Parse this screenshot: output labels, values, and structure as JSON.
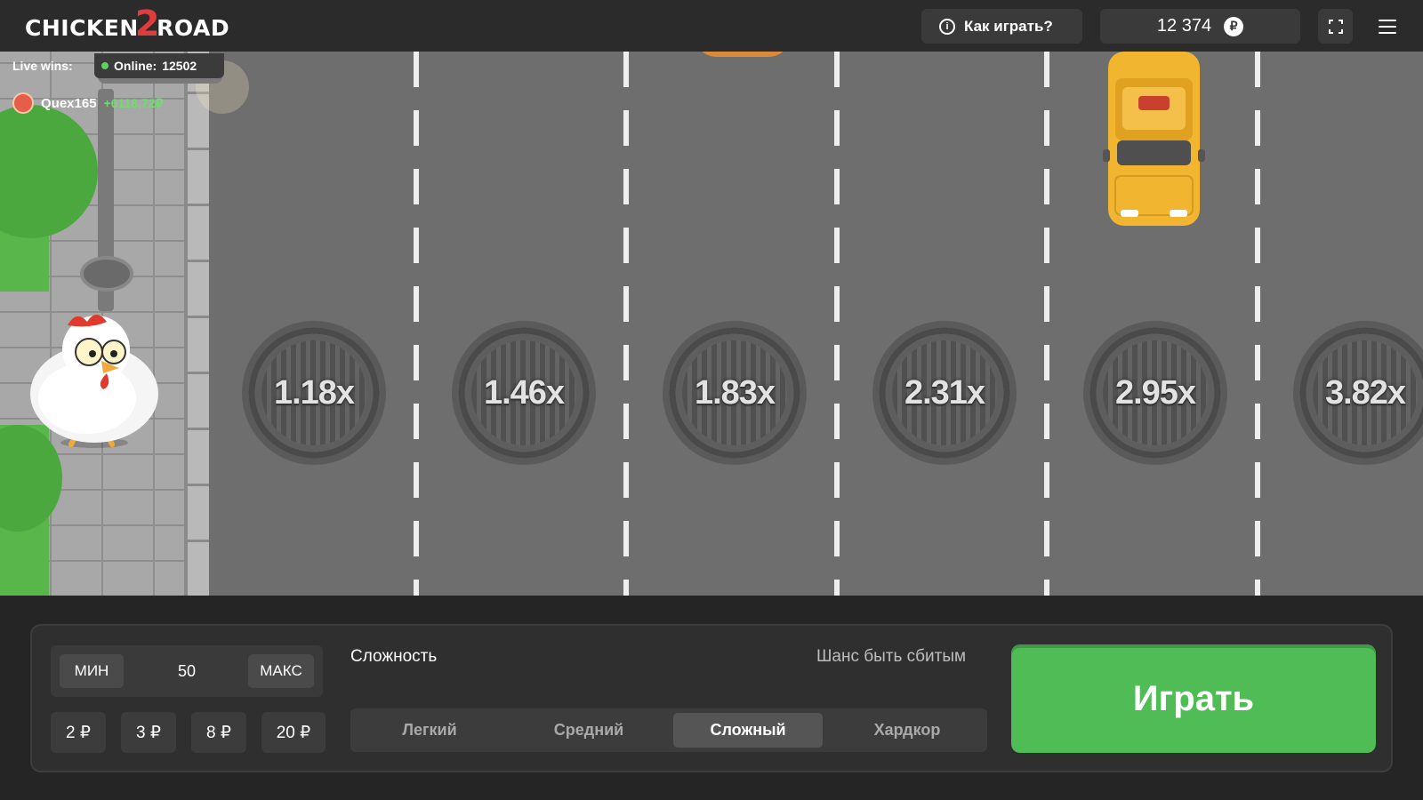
{
  "header": {
    "logo_text_left": "CHICKEN",
    "logo_two": "2",
    "logo_text_right": "ROAD",
    "how_to_play": "Как играть?",
    "info_icon": "info-icon",
    "balance": "12 374",
    "currency_symbol": "₽",
    "fullscreen_icon": "fullscreen-icon",
    "menu_icon": "hamburger-menu-icon"
  },
  "live": {
    "label": "Live wins:",
    "online_label": "Online:",
    "online_count": "12502",
    "winner_name": "Quex165",
    "winner_amount": "+6118,72₽"
  },
  "multipliers": [
    "1.18x",
    "1.46x",
    "1.83x",
    "2.31x",
    "2.95x",
    "3.82x"
  ],
  "bet": {
    "min_label": "МИН",
    "value": "50",
    "max_label": "МАКС",
    "chips": [
      "2 ₽",
      "3 ₽",
      "8 ₽",
      "20 ₽"
    ]
  },
  "difficulty": {
    "label": "Сложность",
    "chance_label": "Шанс быть сбитым",
    "options": [
      "Легкий",
      "Средний",
      "Сложный",
      "Хардкор"
    ],
    "selected": "Сложный"
  },
  "play_button": "Играть",
  "colors": {
    "play_green": "#4fbc55",
    "win_green": "#6fdc6f",
    "taxi_yellow": "#f2b530",
    "logo_red": "#e23b3b"
  }
}
